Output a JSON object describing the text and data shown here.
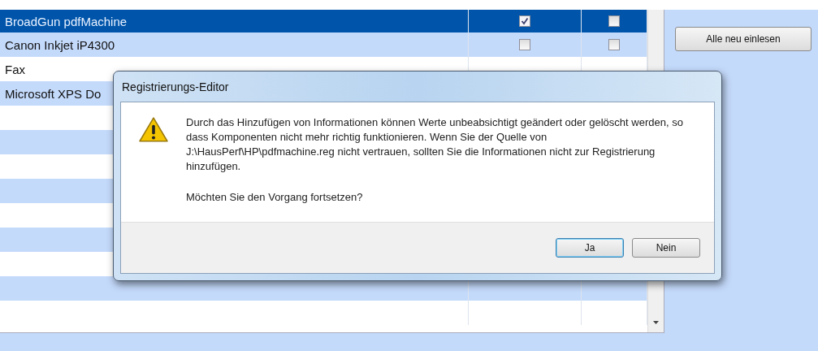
{
  "printers": [
    {
      "name": "BroadGun pdfMachine",
      "selected": true,
      "checks": [
        {
          "checked": true
        },
        {
          "checked": false
        }
      ]
    },
    {
      "name": "Canon Inkjet iP4300",
      "selected": false,
      "checks": [
        {
          "checked": false
        },
        {
          "checked": false
        }
      ]
    },
    {
      "name": "Fax",
      "selected": false
    },
    {
      "name": "Microsoft XPS Do",
      "selected": false
    }
  ],
  "reload_button": "Alle neu einlesen",
  "dialog": {
    "title": "Registrierungs-Editor",
    "message": "Durch das Hinzufügen von Informationen können Werte unbeabsichtigt geändert oder gelöscht werden, so dass Komponenten nicht mehr richtig funktionieren. Wenn Sie der Quelle von J:\\HausPerf\\HP\\pdfmachine.reg nicht vertrauen, sollten Sie die Informationen nicht zur Registrierung hinzufügen.",
    "question": "Möchten Sie den Vorgang fortsetzen?",
    "buttons": [
      {
        "label": "Ja",
        "selected": true
      },
      {
        "label": "Nein",
        "selected": false
      }
    ]
  }
}
